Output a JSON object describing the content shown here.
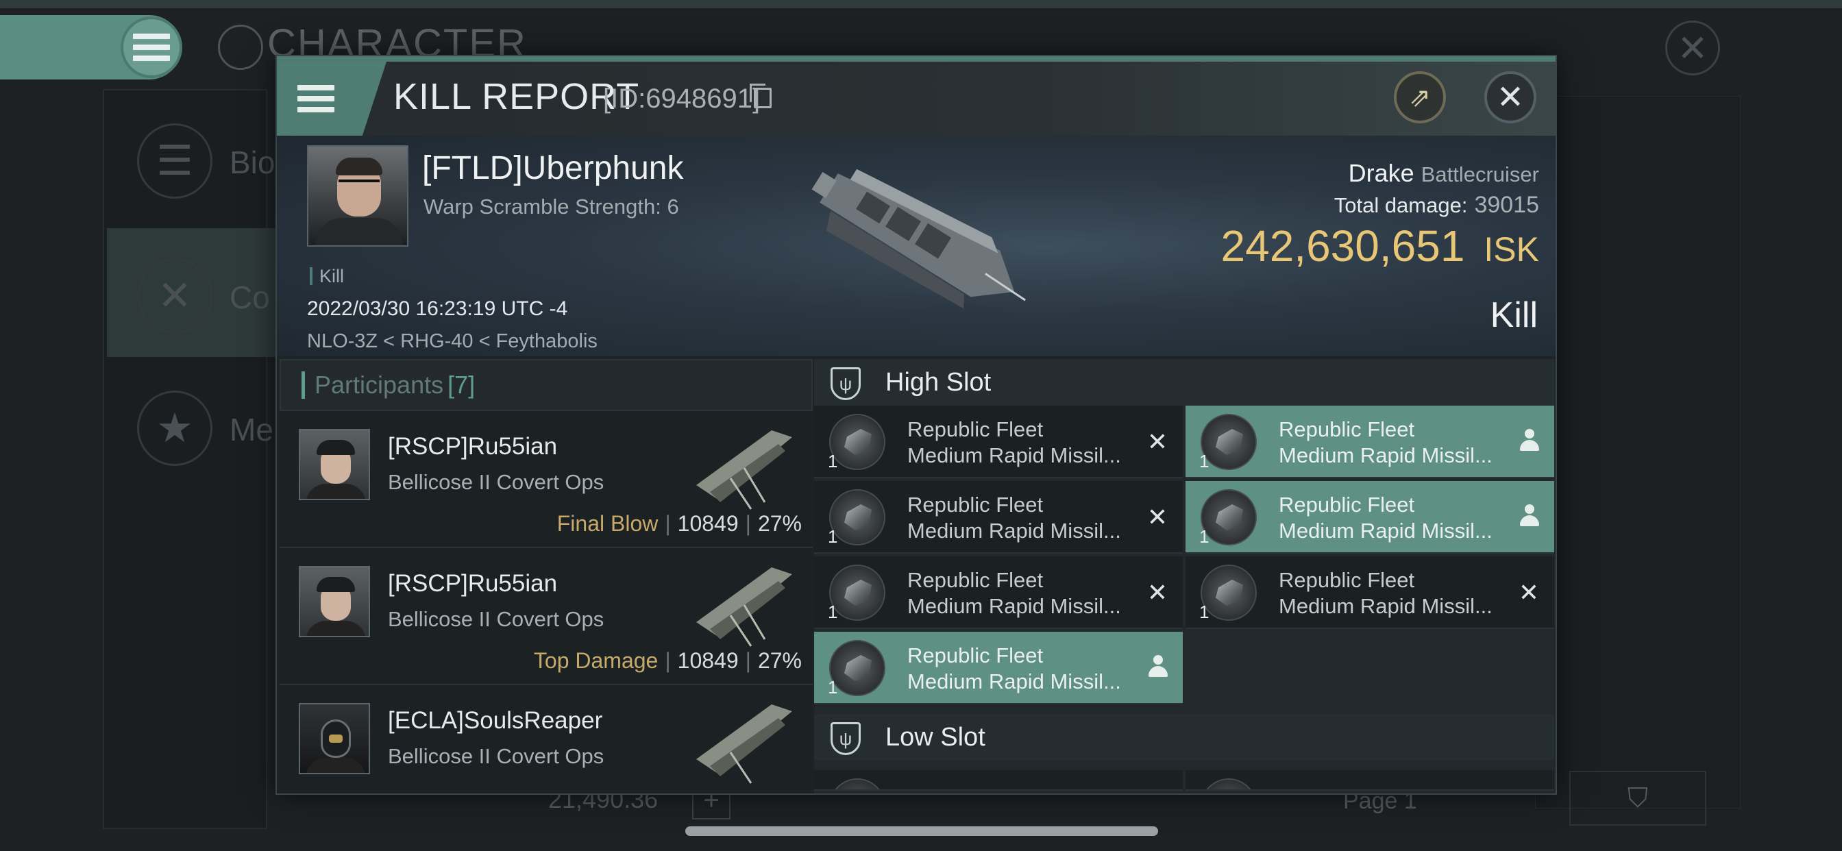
{
  "background": {
    "title": "CHARACTER",
    "side_items": [
      {
        "label": "Bio",
        "icon": "list-icon"
      },
      {
        "label": "Co",
        "icon": "swords-icon"
      },
      {
        "label": "Me",
        "icon": "star-icon"
      }
    ],
    "bottom_value": "21,490.36",
    "page_label": "Page 1"
  },
  "window": {
    "title": "KILL REPORT",
    "id_text": "[ID:6948691]"
  },
  "summary": {
    "pilot_name": "[FTLD]Uberphunk",
    "pilot_sub": "Warp Scramble Strength: 6",
    "tag": "Kill",
    "datetime": "2022/03/30 16:23:19 UTC -4",
    "location": "NLO-3Z < RHG-40 < Feythabolis",
    "ship_name": "Drake",
    "ship_class": "Battlecruiser",
    "damage_label": "Total damage:",
    "damage_value": "39015",
    "isk_value": "242,630,651",
    "isk_unit": "ISK",
    "result": "Kill"
  },
  "participants": {
    "label": "Participants",
    "count": "[7]",
    "rows": [
      {
        "name": "[RSCP]Ru55ian",
        "ship": "Bellicose II Covert Ops",
        "tag": "Final Blow",
        "damage": "10849",
        "percent": "27%"
      },
      {
        "name": "[RSCP]Ru55ian",
        "ship": "Bellicose II Covert Ops",
        "tag": "Top Damage",
        "damage": "10849",
        "percent": "27%"
      },
      {
        "name": "[ECLA]SoulsReaper",
        "ship": "Bellicose II Covert Ops",
        "tag": "",
        "damage": "",
        "percent": ""
      }
    ]
  },
  "high_slot": {
    "label": "High Slot",
    "modules": [
      {
        "line1": "Republic Fleet",
        "line2": "Medium Rapid Missil...",
        "qty": "1",
        "state": "destroyed"
      },
      {
        "line1": "Republic Fleet",
        "line2": "Medium Rapid Missil...",
        "qty": "1",
        "state": "dropped"
      },
      {
        "line1": "Republic Fleet",
        "line2": "Medium Rapid Missil...",
        "qty": "1",
        "state": "destroyed"
      },
      {
        "line1": "Republic Fleet",
        "line2": "Medium Rapid Missil...",
        "qty": "1",
        "state": "dropped"
      },
      {
        "line1": "Republic Fleet",
        "line2": "Medium Rapid Missil...",
        "qty": "1",
        "state": "destroyed"
      },
      {
        "line1": "Republic Fleet",
        "line2": "Medium Rapid Missil...",
        "qty": "1",
        "state": "destroyed"
      },
      {
        "line1": "Republic Fleet",
        "line2": "Medium Rapid Missil...",
        "qty": "1",
        "state": "dropped"
      }
    ]
  },
  "low_slot": {
    "label": "Low Slot"
  },
  "colors": {
    "accent": "#5e9084",
    "isk": "#e8c776",
    "tag": "#c7a969"
  }
}
